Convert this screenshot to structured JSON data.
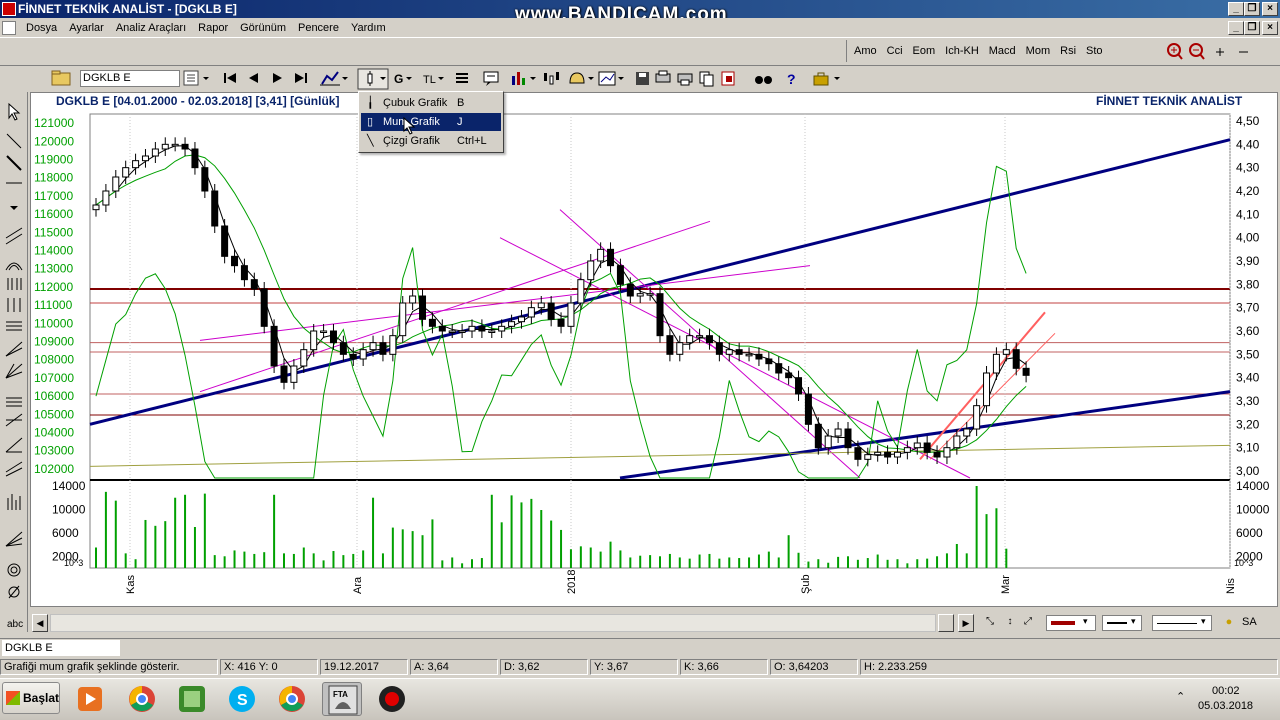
{
  "window": {
    "title": "FİNNET TEKNİK ANALİST - [DGKLB E]",
    "watermark": "www.BANDICAM.com"
  },
  "menu": [
    "Dosya",
    "Ayarlar",
    "Analiz Araçları",
    "Rapor",
    "Görünüm",
    "Pencere",
    "Yardım"
  ],
  "indicator_buttons": [
    "Amo",
    "Cci",
    "Eom",
    "Ich-KH",
    "Macd",
    "Mom",
    "Rsi",
    "Sto"
  ],
  "toolbar": {
    "symbol": "DGKLB E",
    "g_label": "G",
    "currency": "TL"
  },
  "chart": {
    "header_left": "DGKLB E  [04.01.2000 - 02.03.2018]  [3,41]  [Günlük]",
    "header_right": "FİNNET TEKNİK ANALİST",
    "left_axis": [
      "121000",
      "120000",
      "119000",
      "118000",
      "117000",
      "116000",
      "115000",
      "114000",
      "113000",
      "112000",
      "111000",
      "110000",
      "109000",
      "108000",
      "107000",
      "106000",
      "105000",
      "104000",
      "103000",
      "102000"
    ],
    "right_axis": [
      "4,50",
      "4,40",
      "4,30",
      "4,20",
      "4,10",
      "4,00",
      "3,90",
      "3,80",
      "3,70",
      "3,60",
      "3,50",
      "3,40",
      "3,30",
      "3,20",
      "3,10",
      "3,00"
    ],
    "volume_left": [
      "14000",
      "10000",
      "6000",
      "2000"
    ],
    "volume_right": [
      "14000",
      "10000",
      "6000",
      "2000"
    ],
    "volume_unit": "10^3",
    "x_labels": [
      "Kas",
      "Ara",
      "2018",
      "Şub",
      "Mar",
      "Nis"
    ],
    "colors": {
      "candle": "#000000",
      "ma_short": "#000000",
      "ma_long": "#00a000",
      "oscillator": "#00a000",
      "channel_blue": "#000080",
      "channel_magenta": "#cc00cc",
      "support_red": "#800000",
      "trend_pink": "#ff6060",
      "volume": "#00a000",
      "price_labels": "#00a000"
    }
  },
  "chart_data": {
    "type": "candlestick",
    "title": "DGKLB E  [04.01.2000 - 02.03.2018]  [3,41]  [Günlük]",
    "y_right_range": [
      2.97,
      4.53
    ],
    "y_left_range": [
      101500,
      121500
    ],
    "volume_range": [
      0,
      14000
    ],
    "x_labels": [
      "Kas",
      "Ara",
      "2018",
      "Şub",
      "Mar",
      "Nis"
    ],
    "closes": [
      4.14,
      4.2,
      4.26,
      4.3,
      4.33,
      4.35,
      4.38,
      4.4,
      4.4,
      4.38,
      4.3,
      4.2,
      4.05,
      3.92,
      3.88,
      3.82,
      3.78,
      3.62,
      3.45,
      3.38,
      3.45,
      3.52,
      3.6,
      3.6,
      3.55,
      3.5,
      3.48,
      3.52,
      3.55,
      3.5,
      3.58,
      3.72,
      3.75,
      3.65,
      3.62,
      3.6,
      3.6,
      3.6,
      3.62,
      3.6,
      3.6,
      3.62,
      3.64,
      3.66,
      3.7,
      3.72,
      3.65,
      3.62,
      3.72,
      3.82,
      3.9,
      3.95,
      3.88,
      3.8,
      3.75,
      3.76,
      3.76,
      3.58,
      3.5,
      3.55,
      3.58,
      3.58,
      3.55,
      3.5,
      3.52,
      3.5,
      3.5,
      3.48,
      3.46,
      3.42,
      3.4,
      3.33,
      3.2,
      3.1,
      3.15,
      3.18,
      3.1,
      3.05,
      3.07,
      3.08,
      3.06,
      3.08,
      3.1,
      3.12,
      3.08,
      3.06,
      3.1,
      3.15,
      3.18,
      3.28,
      3.42,
      3.5,
      3.52,
      3.44,
      3.41
    ],
    "volumes": [
      3500,
      13000,
      11500,
      2500,
      1500,
      8200,
      7200,
      8000,
      12000,
      12500,
      7000,
      12700,
      2200,
      2000,
      3000,
      2800,
      2400,
      2700,
      12500,
      2500,
      2400,
      3500,
      2500,
      1300,
      2900,
      2200,
      2400,
      3000,
      12000,
      2500,
      6900,
      6600,
      6300,
      5600,
      8300,
      1300,
      1800,
      800,
      1500,
      1700,
      12500,
      7800,
      12400,
      11200,
      11800,
      9900,
      8100,
      6500,
      3200,
      3700,
      3500,
      2800,
      4500,
      3000,
      1800,
      2100,
      2200,
      2000,
      2400,
      1800,
      1600,
      2300,
      2400,
      1600,
      1800,
      1700,
      1800,
      2300,
      2800,
      1800,
      5600,
      2600,
      1100,
      1500,
      900,
      1900,
      2000,
      1400,
      1700,
      2300,
      1400,
      1500,
      800,
      1500,
      1600,
      2000,
      2500,
      4100,
      2500,
      14000,
      9200,
      10200,
      3300
    ]
  },
  "dropdown": [
    {
      "label": "Çubuk Grafik",
      "shortcut": "B"
    },
    {
      "label": "Mum Grafik",
      "shortcut": "J"
    },
    {
      "label": "Çizgi Grafik",
      "shortcut": "Ctrl+L"
    }
  ],
  "bottom_right_controls": {
    "sa_label": "SA"
  },
  "symbol_tab": "DGKLB E",
  "status": {
    "message": "Grafiği mum  grafik şeklinde gösterir.",
    "xy": "X: 416 Y: 0",
    "date": "19.12.2017",
    "a": "A: 3,64",
    "d": "D: 3,62",
    "y": "Y: 3,67",
    "k": "K: 3,66",
    "o": "O: 3,64203",
    "h": "H: 2.233.259"
  },
  "taskbar": {
    "start_label": "Başlat",
    "time": "00:02",
    "date": "05.03.2018"
  }
}
